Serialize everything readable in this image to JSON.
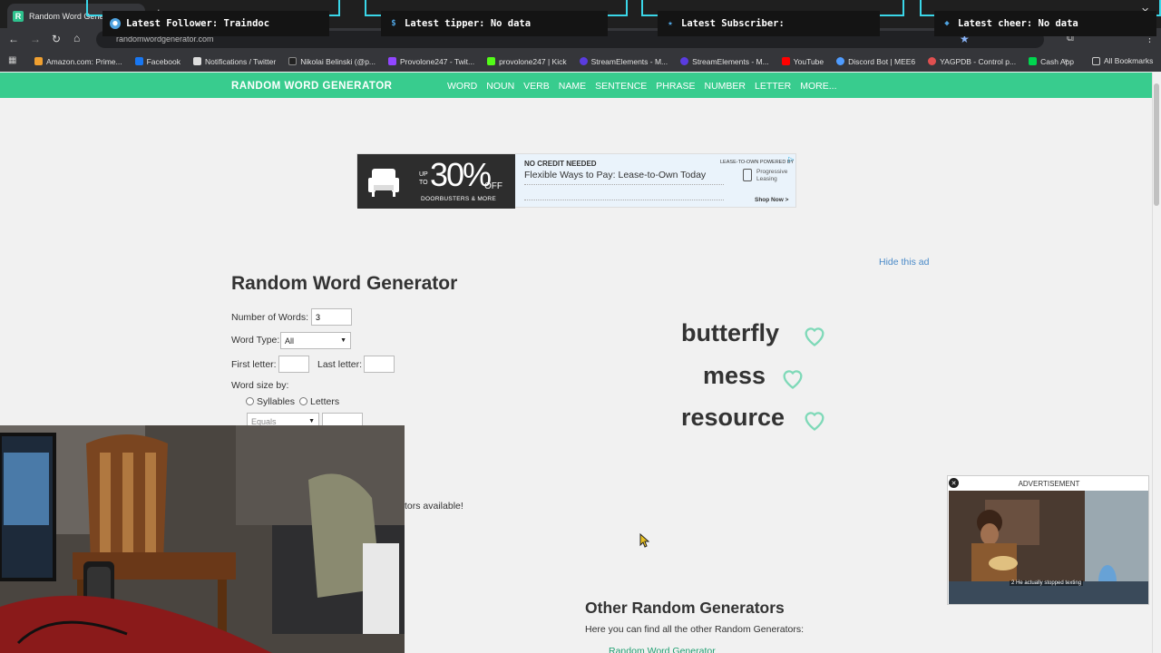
{
  "browser": {
    "tab_title": "Random Word Generato",
    "url": "randomwordgenerator.com",
    "bookmarks": [
      {
        "label": "Amazon.com: Prime...",
        "color": "#f0a030"
      },
      {
        "label": "Facebook",
        "color": "#1877f2"
      },
      {
        "label": "Notifications / Twitter",
        "color": "#dddddd"
      },
      {
        "label": "Nikolai Belinski (@p...",
        "color": "#222222"
      },
      {
        "label": "Provolone247 - Twit...",
        "color": "#9146ff"
      },
      {
        "label": "provolone247 | Kick",
        "color": "#53fc18"
      },
      {
        "label": "StreamElements - M...",
        "color": "#5a3ce0"
      },
      {
        "label": "StreamElements - M...",
        "color": "#5a3ce0"
      },
      {
        "label": "YouTube",
        "color": "#ff0000"
      },
      {
        "label": "Discord Bot | MEE6",
        "color": "#4f9cff"
      },
      {
        "label": "YAGPDB - Control p...",
        "color": "#e05050"
      },
      {
        "label": "Cash App",
        "color": "#00d64f"
      }
    ],
    "all_bookmarks": "All Bookmarks"
  },
  "overlay": {
    "follower": "Latest Follower: Traindoc",
    "tipper": "Latest tipper: No data",
    "subscriber": "Latest Subscriber:",
    "cheer": "Latest cheer: No data"
  },
  "site": {
    "brand": "RANDOM WORD GENERATOR",
    "nav": [
      "WORD",
      "NOUN",
      "VERB",
      "NAME",
      "SENTENCE",
      "PHRASE",
      "NUMBER",
      "LETTER",
      "MORE..."
    ]
  },
  "ad": {
    "pct": "30%",
    "up_to": "UP TO",
    "off": "OFF",
    "doorbusters": "DOORBUSTERS & MORE",
    "headline": "NO CREDIT NEEDED",
    "sub": "Flexible Ways to Pay: Lease-to-Own Today",
    "powered": "LEASE-TO-OWN POWERED BY",
    "brand": "Progressive Leasing",
    "cta": "Shop Now >"
  },
  "hide_ad": "Hide this ad",
  "form": {
    "title": "Random Word Generator",
    "num_words_label": "Number of Words:",
    "num_words_value": "3",
    "word_type_label": "Word Type:",
    "word_type_value": "All",
    "first_letter_label": "First letter:",
    "last_letter_label": "Last letter:",
    "word_size_label": "Word size by:",
    "syllables": "Syllables",
    "letters": "Letters",
    "equals": "Equals",
    "more_text": "tors available!"
  },
  "words": [
    "butterfly",
    "mess",
    "resource"
  ],
  "popup_ad": {
    "label": "ADVERTISEMENT",
    "caption": "2 He actually stopped texting"
  },
  "other": {
    "title": "Other Random Generators",
    "desc": "Here you can find all the other Random Generators:",
    "first_link": "Random Word Generator"
  },
  "colors": {
    "brand_green": "#38cc8e",
    "heart": "#7fd9b8"
  }
}
